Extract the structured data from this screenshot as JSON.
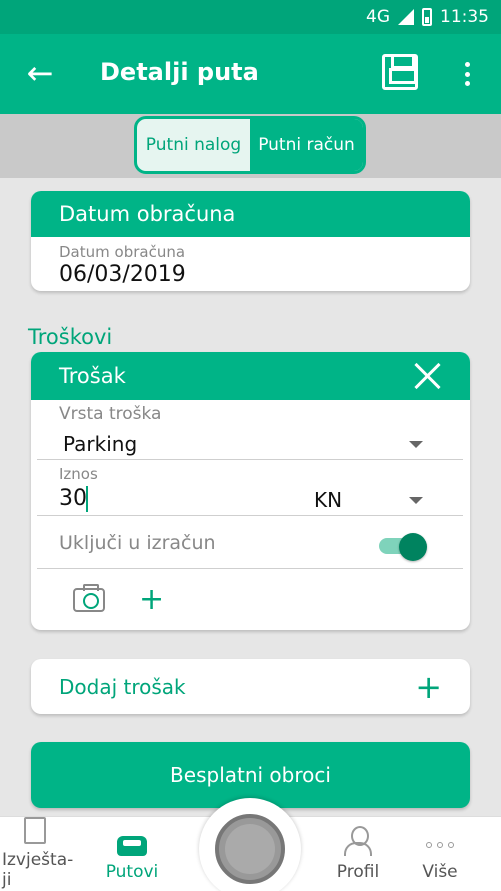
{
  "status_bar": {
    "network": "4G",
    "network_small": "4G",
    "time": "11:35"
  },
  "app_bar": {
    "title": "Detalji puta",
    "back_icon": "arrow-left-icon",
    "save_icon": "floppy-disk-icon",
    "more_icon": "more-vert-icon"
  },
  "tabs": [
    {
      "label": "Putni nalog",
      "active": false
    },
    {
      "label": "Putni račun",
      "active": true
    }
  ],
  "settlement_card": {
    "header": "Datum obračuna",
    "field_label": "Datum obračuna",
    "field_value": "06/03/2019"
  },
  "costs_section": {
    "label": "Troškovi"
  },
  "cost_card": {
    "header": "Trošak",
    "type_label": "Vrsta troška",
    "type_value": "Parking",
    "amount_label": "Iznos",
    "amount_value": "30",
    "currency_value": "KN",
    "include_label": "Uključi u izračun",
    "include_on": true
  },
  "add_cost": {
    "label": "Dodaj trošak"
  },
  "free_meals_button": {
    "label": "Besplatni obroci"
  },
  "bottom_nav": {
    "items": [
      {
        "label": "Izvješta-\nji",
        "icon": "document-icon",
        "active": false
      },
      {
        "label": "Putovi",
        "icon": "car-icon",
        "active": true
      },
      {
        "label": "Profil",
        "icon": "person-icon",
        "active": false
      },
      {
        "label": "Više",
        "icon": "more-horiz-icon",
        "active": false
      }
    ]
  },
  "colors": {
    "primary": "#00b487",
    "primary_dark": "#00a57a",
    "toggle_knob": "#00835f"
  }
}
